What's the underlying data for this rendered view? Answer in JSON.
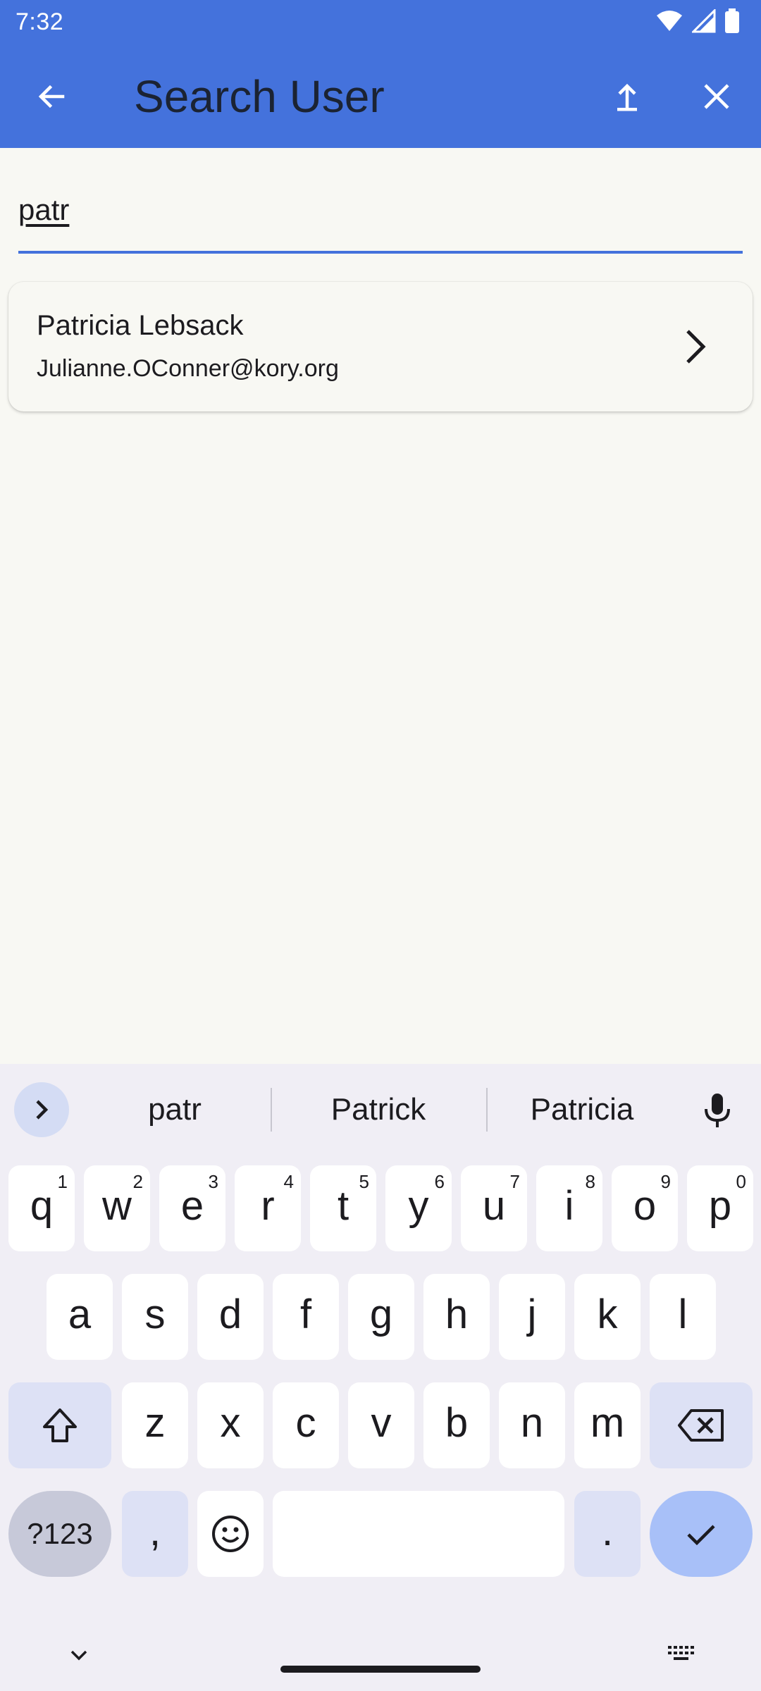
{
  "status_bar": {
    "time": "7:32"
  },
  "app_bar": {
    "title": "Search User"
  },
  "search": {
    "value": "patr",
    "placeholder": ""
  },
  "results": [
    {
      "name": "Patricia Lebsack",
      "email": "Julianne.OConner@kory.org"
    }
  ],
  "keyboard": {
    "suggestions": [
      "patr",
      "Patrick",
      "Patricia"
    ],
    "row1": [
      {
        "key": "q",
        "hint": "1"
      },
      {
        "key": "w",
        "hint": "2"
      },
      {
        "key": "e",
        "hint": "3"
      },
      {
        "key": "r",
        "hint": "4"
      },
      {
        "key": "t",
        "hint": "5"
      },
      {
        "key": "y",
        "hint": "6"
      },
      {
        "key": "u",
        "hint": "7"
      },
      {
        "key": "i",
        "hint": "8"
      },
      {
        "key": "o",
        "hint": "9"
      },
      {
        "key": "p",
        "hint": "0"
      }
    ],
    "row2": [
      "a",
      "s",
      "d",
      "f",
      "g",
      "h",
      "j",
      "k",
      "l"
    ],
    "row3": [
      "z",
      "x",
      "c",
      "v",
      "b",
      "n",
      "m"
    ],
    "symbols_label": "?123",
    "comma_label": ",",
    "period_label": "."
  },
  "colors": {
    "primary": "#4472dc",
    "background": "#f8f8f3",
    "keyboard_bg": "#f0eef5",
    "modifier_key": "#dde1f5",
    "enter_key": "#a8c0f8"
  }
}
